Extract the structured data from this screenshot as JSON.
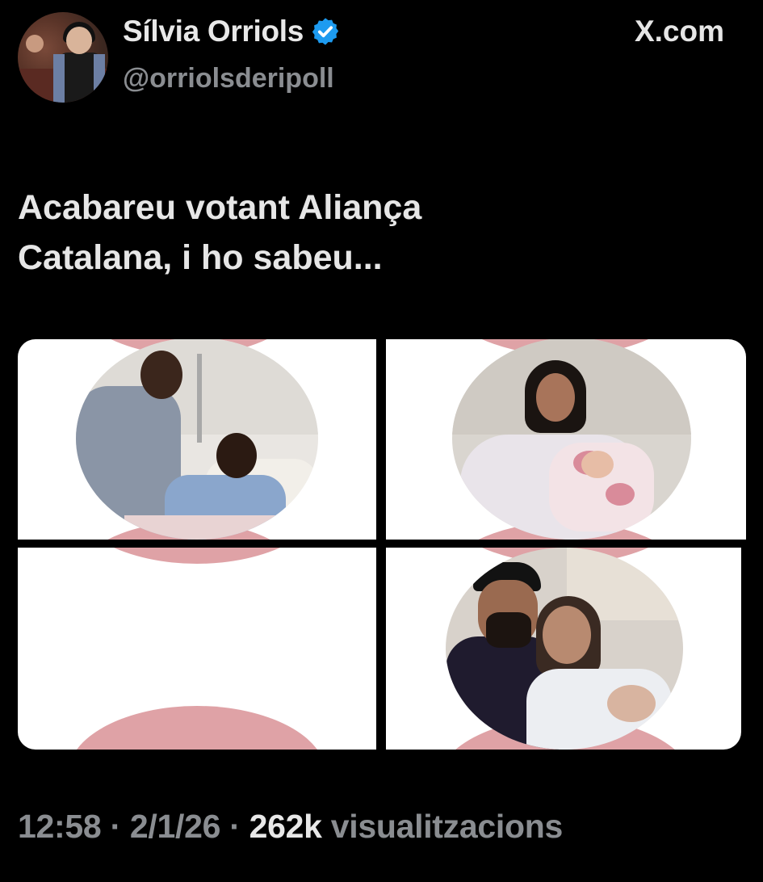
{
  "post": {
    "author_name": "Sílvia Orriols",
    "handle": "@orriolsderipoll",
    "platform_label": "X.com",
    "text": "Acabareu votant Aliança\nCatalana, i ho sabeu...",
    "time": "12:58",
    "separator": " · ",
    "date": "2/1/26",
    "views_count": "262k",
    "views_label": " visualitzacions"
  },
  "colors": {
    "background": "#000000",
    "verified": "#1d9bf0",
    "accent_pink": "#dfa2a6",
    "muted_text": "#8a8d91"
  },
  "media": [
    {
      "name": "newborn-photo-family-1"
    },
    {
      "name": "newborn-photo-mother-2"
    },
    {
      "name": "blank-tile"
    },
    {
      "name": "newborn-photo-couple-4"
    }
  ],
  "icons": {
    "verified": "verified-badge-icon",
    "avatar": "profile-avatar"
  }
}
